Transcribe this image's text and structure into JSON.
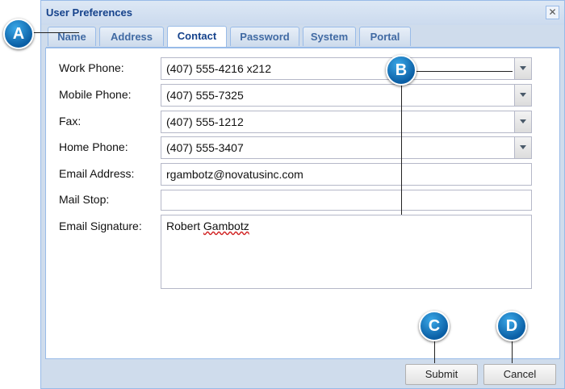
{
  "window": {
    "title": "User Preferences",
    "close_label": "✕"
  },
  "tabs": [
    {
      "label": "Name"
    },
    {
      "label": "Address"
    },
    {
      "label": "Contact"
    },
    {
      "label": "Password"
    },
    {
      "label": "System"
    },
    {
      "label": "Portal"
    }
  ],
  "active_tab": "Contact",
  "form": {
    "work_phone": {
      "label": "Work Phone:",
      "value": "(407) 555-4216 x212"
    },
    "mobile_phone": {
      "label": "Mobile Phone:",
      "value": "(407) 555-7325"
    },
    "fax": {
      "label": "Fax:",
      "value": "(407) 555-1212"
    },
    "home_phone": {
      "label": "Home Phone:",
      "value": "(407) 555-3407"
    },
    "email": {
      "label": "Email Address:",
      "value": "rgambotz@novatusinc.com"
    },
    "mail_stop": {
      "label": "Mail Stop:",
      "value": ""
    },
    "signature": {
      "label": "Email Signature:",
      "first": "Robert ",
      "misspelled": "Gambotz"
    }
  },
  "buttons": {
    "submit": "Submit",
    "cancel": "Cancel"
  },
  "callouts": {
    "a": "A",
    "b": "B",
    "c": "C",
    "d": "D"
  },
  "colors": {
    "accent": "#15428b",
    "callout": "#1a7fc8",
    "border": "#99bbe8"
  }
}
